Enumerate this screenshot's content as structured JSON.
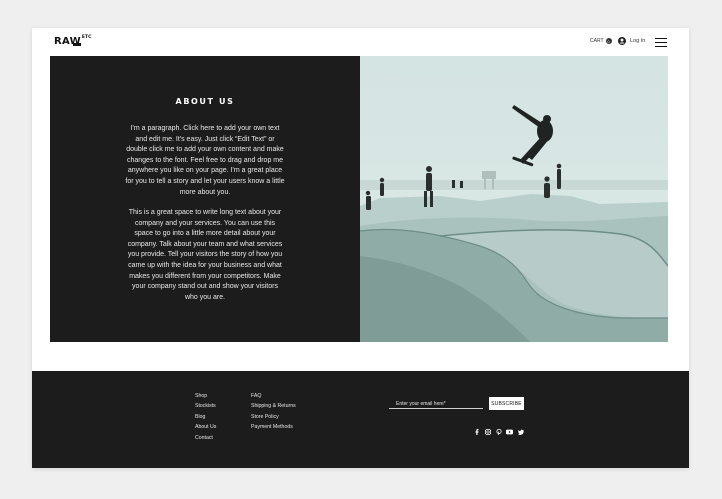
{
  "header": {
    "logo_text": "RAW",
    "logo_sup": "ETC",
    "cart_label": "CART",
    "cart_count": "0",
    "login_label": "Log In",
    "icons": [
      "user-icon",
      "hamburger-menu-icon"
    ]
  },
  "about": {
    "title": "ABOUT US",
    "paragraph1": "I'm a paragraph. Click here to add your own text and edit me. It's easy. Just click “Edit Text” or double click me to add your own content and make changes to the font. Feel free to drag and drop me anywhere you like on your page. I'm a great place for you to tell a story and let your users know a little more about you.",
    "paragraph2": "This is a great space to write long text about your company and your services. You can use this space to go into a little more detail about your company. Talk about your team and what services you provide. Tell your visitors the story of how you came up with the idea for your business and what makes you different from your competitors. Make your company stand out and show your visitors who you are."
  },
  "footer": {
    "links_col1": [
      "Shop",
      "Stockists",
      "Blog",
      "About Us",
      "Contact"
    ],
    "links_col2": [
      "FAQ",
      "Shipping & Returns",
      "Store Policy",
      "Payment Methods"
    ],
    "email_placeholder": "Enter your email here*",
    "subscribe_label": "SUBSCRIBE",
    "social_icons": [
      "facebook-icon",
      "instagram-icon",
      "pinterest-icon",
      "youtube-icon",
      "twitter-icon"
    ]
  },
  "colors": {
    "background": "#efefef",
    "panel": "#1c1c1c",
    "photo_tint": "#cfe1df"
  }
}
